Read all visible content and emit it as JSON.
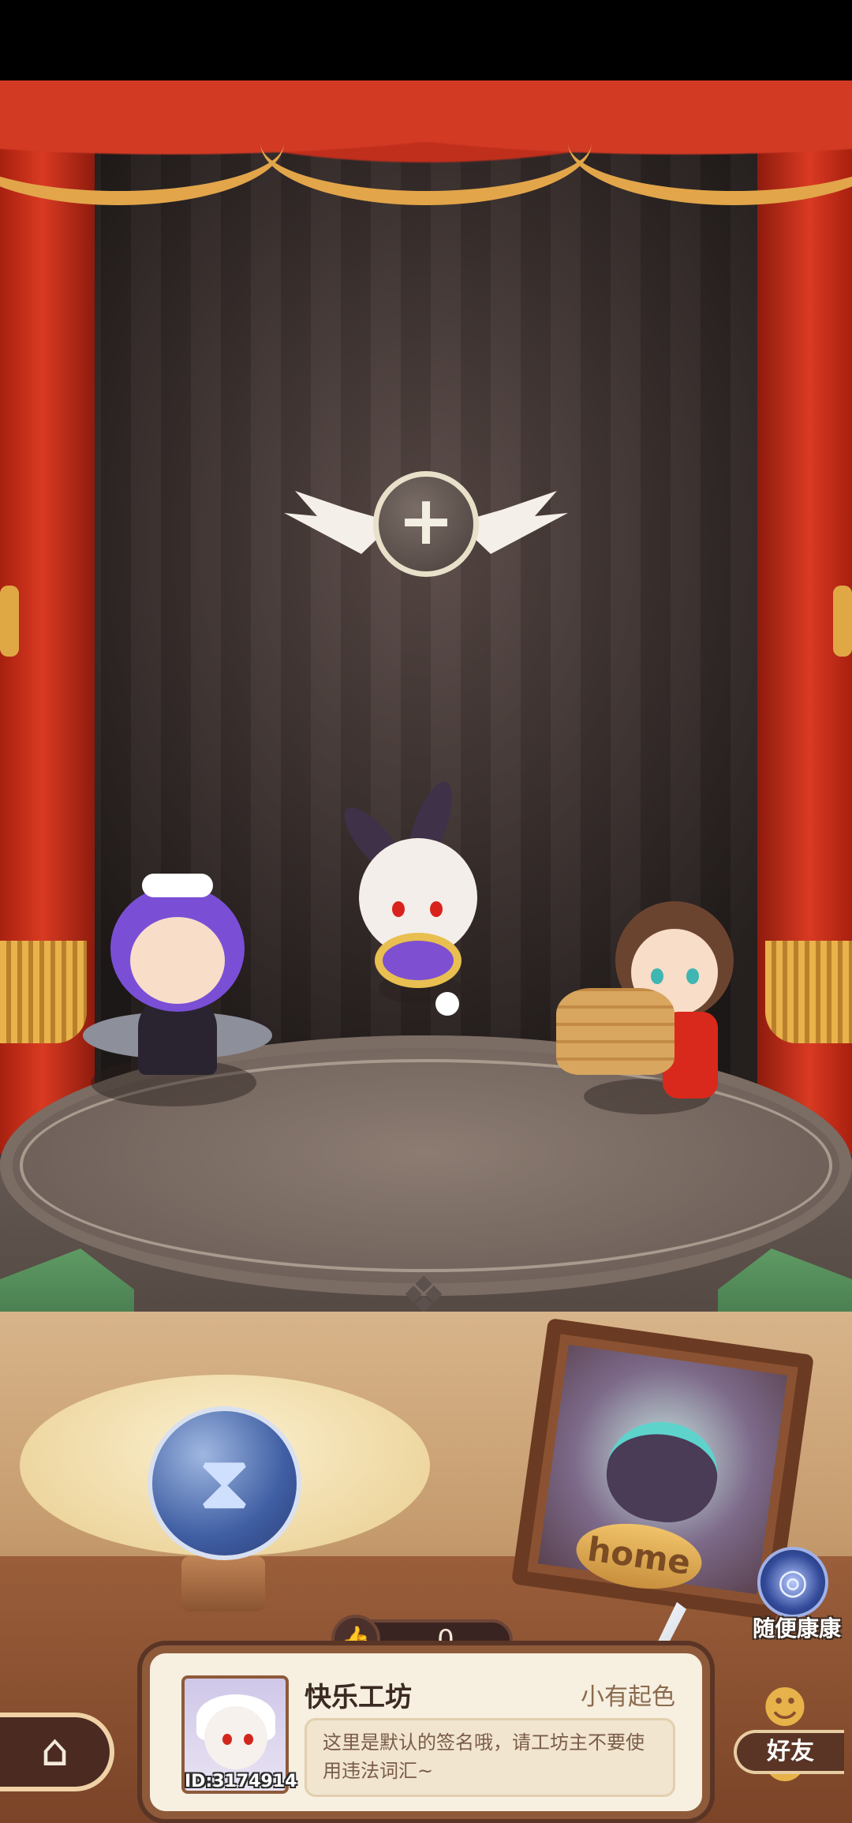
{
  "workshop": {
    "name": "快乐工坊",
    "rank": "小有起色",
    "signature": "这里是默认的签名哦，请工坊主不要使用违法词汇~",
    "user_id": "ID:3174914",
    "like_count": "0"
  },
  "buttons": {
    "random_visit": "随便康康",
    "friends": "好友",
    "home_sign": "home"
  },
  "icons": {
    "add_slot": "plus-icon",
    "hourglass": "hourglass-icon",
    "home": "home-icon",
    "like": "thumbs-up-icon",
    "friends": "friends-icon",
    "random_visit": "portal-icon",
    "quill": "quill-icon"
  },
  "colors": {
    "curtain": "#d23a24",
    "fringe": "#e9b24a",
    "card_bg": "#f7efe0",
    "card_border": "#8e5a3a"
  }
}
